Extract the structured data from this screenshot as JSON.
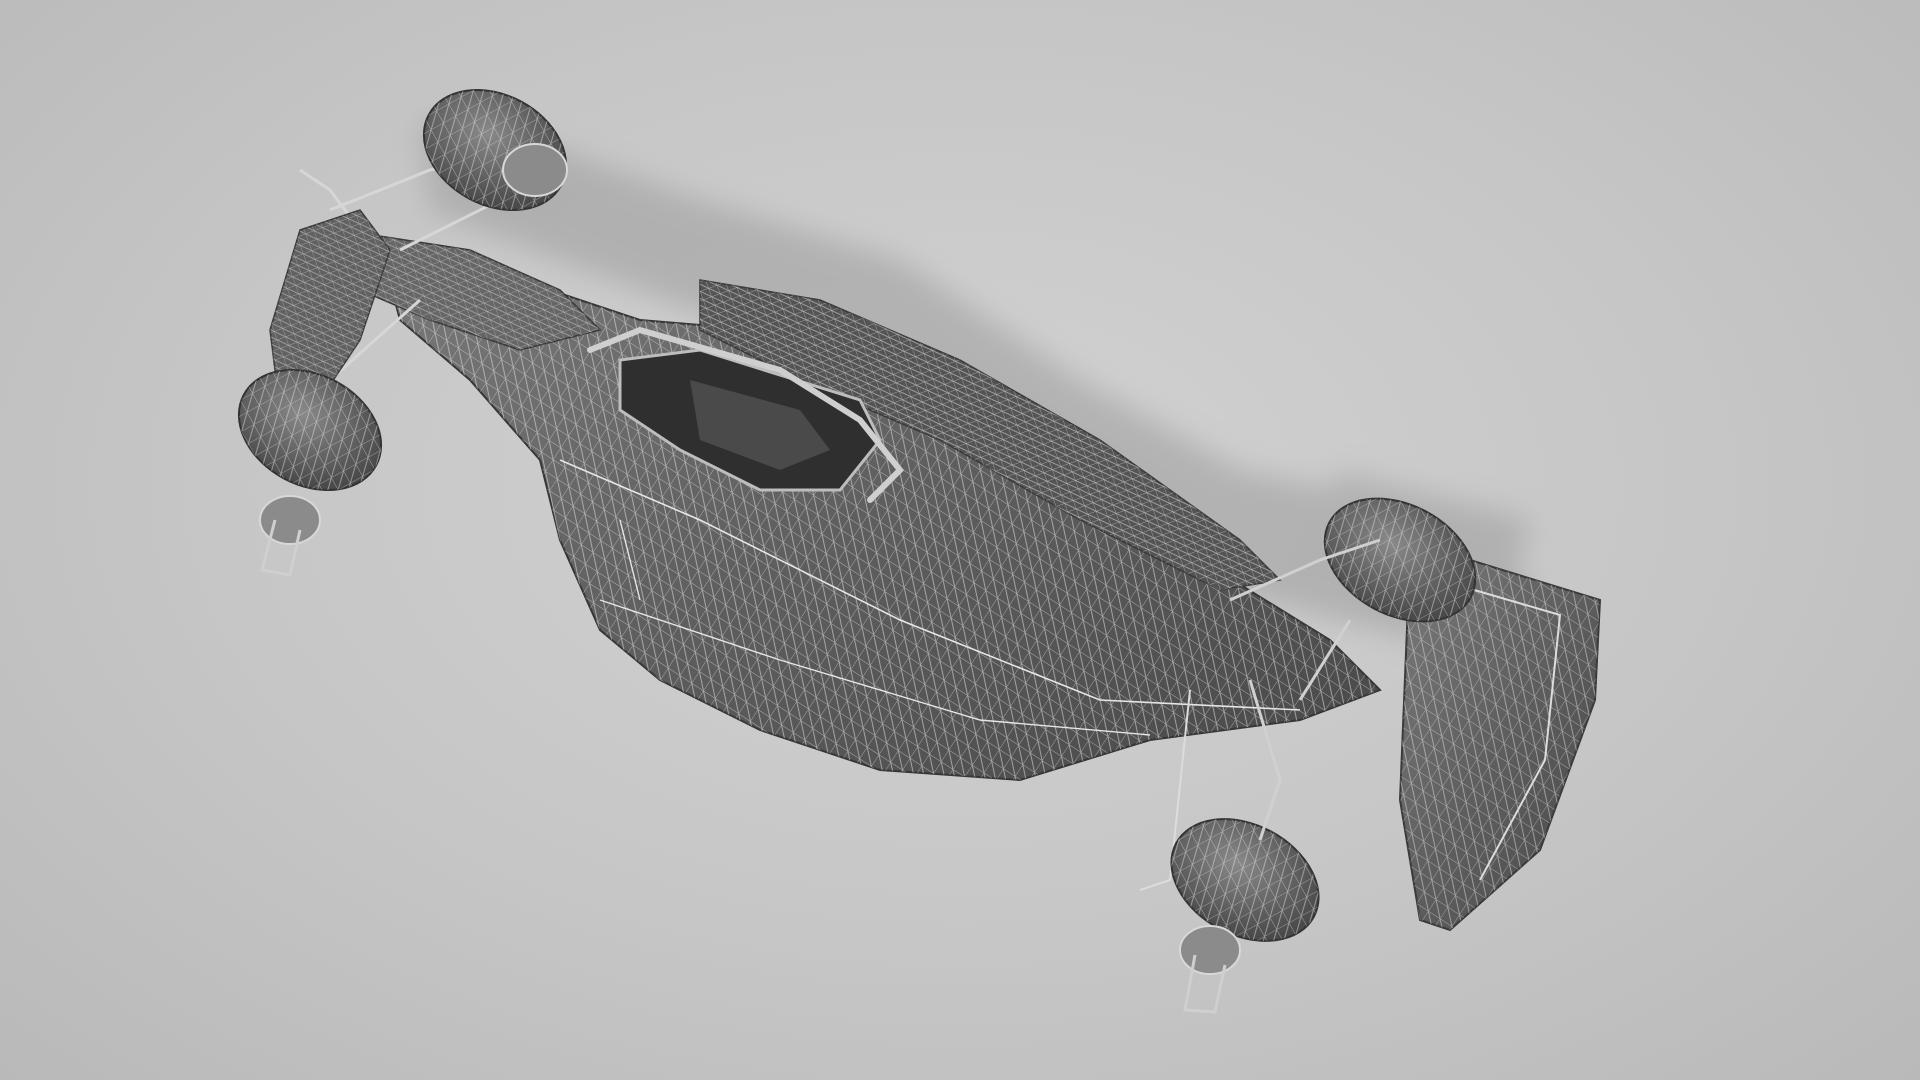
{
  "scene": {
    "subject": "formula-car-wireframe-render",
    "view": "top-down",
    "colors": {
      "background": "#c8c8c8",
      "shadow": "#a9a9a9",
      "body": "#5c5c5c",
      "body_dark": "#3f3f3f",
      "body_light": "#7a7a7a",
      "wire": "#e4e4e4",
      "metal": "#9a9a9a"
    }
  }
}
